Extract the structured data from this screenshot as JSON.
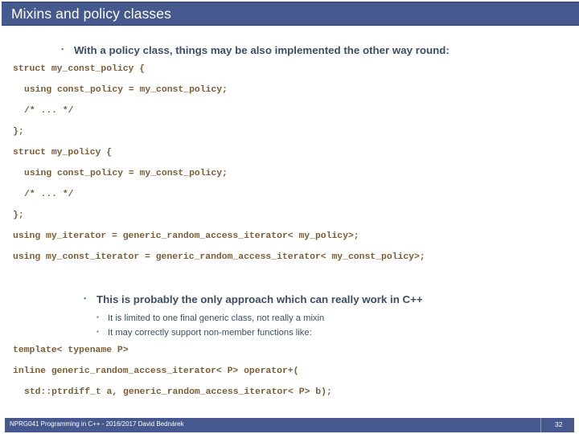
{
  "slide": {
    "title": "Mixins and policy classes",
    "theme": {
      "accent": "#46598F",
      "title_text": "#FFFFFF",
      "body_text": "#3D4E63",
      "code_text": "#7B5E35",
      "bullet": "#6B7B91",
      "background": "#FFFFFF"
    }
  },
  "bullets": {
    "main": {
      "marker": "▪",
      "text": "With a policy class, things may be also implemented the other way round:"
    },
    "second": {
      "marker": "▪",
      "text": "This is probably the only approach which can really work in C++"
    },
    "sub": [
      {
        "marker": "▪",
        "text": "It is limited to one final generic class, not really a mixin"
      },
      {
        "marker": "▪",
        "text": "It may correctly support non-member functions like:"
      }
    ]
  },
  "code_block_1": [
    {
      "text": "struct my_const_policy {",
      "indent": 0
    },
    {
      "text": "using const_policy = my_const_policy;",
      "indent": 1
    },
    {
      "text": "/* ... */",
      "indent": 1
    },
    {
      "text": "};",
      "indent": 0
    },
    {
      "text": "struct my_policy {",
      "indent": 0
    },
    {
      "text": "using const_policy = my_const_policy;",
      "indent": 1
    },
    {
      "text": "/* ... */",
      "indent": 1
    },
    {
      "text": "};",
      "indent": 0
    },
    {
      "text": "using my_iterator = generic_random_access_iterator< my_policy>;",
      "indent": 0
    },
    {
      "text": "using my_const_iterator = generic_random_access_iterator< my_const_policy>;",
      "indent": 0
    }
  ],
  "code_block_2": [
    {
      "text": "template< typename P>",
      "indent": 0
    },
    {
      "text": "inline generic_random_access_iterator< P> operator+(",
      "indent": 0
    },
    {
      "text": "std::ptrdiff_t a, generic_random_access_iterator< P> b);",
      "indent": 1
    }
  ],
  "footer": {
    "course": "NPRG041 Programming in C++ - 2016/2017 David Bednárek",
    "page": "32"
  }
}
